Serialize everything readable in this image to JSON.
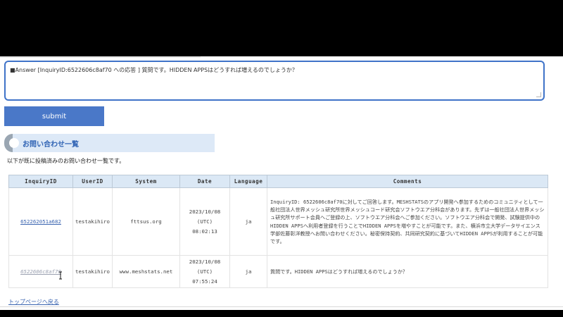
{
  "answer_field": {
    "value": "■Answer [InquiryID:6522606c8af70 への応答 ] 質問です。HIDDEN APPSはどうすれば増えるのでしょうか？"
  },
  "submit_label": "submit",
  "section": {
    "title": "お問い合わせ一覧",
    "intro": "以下が既に投稿済みのお問い合わせ一覧です。"
  },
  "table": {
    "headers": [
      "InquiryID",
      "UserID",
      "System",
      "Date",
      "Language",
      "Comments"
    ],
    "rows": [
      {
        "inquiry_id": "652262051a682",
        "user_id": "testakihiro",
        "system": "fttsus.org",
        "date": "2023/10/08",
        "tz": "(UTC)",
        "time": "08:02:13",
        "language": "ja",
        "comments": "InquiryID: 6522606c8af70に対してご回答します。MESHSTATSのアプリ開発へ参加するためのコミュニティとして一般社団法人世界メッシュ研究所世界メッシュコード研究会ソフトウエア分科会があります。先ずは一般社団法人世界メッシュ研究所サポート会員へご登録の上、ソフトウエア分科会へご参加ください。ソフトウエア分科会で開発、試験提供中のHIDDEN APPSへ利用者登録を行うことでHIDDEN APPSを増やすことが可能です。また、横浜市立大学データサイエンス学部佐藤彰洋教授へお問い合わせください。秘密保持契約、共同研究契約に基づいてHIDDEN APPSが利用することが可能です。"
      },
      {
        "inquiry_id": "6522606c8af70",
        "user_id": "testakihiro",
        "system": "www.meshstats.net",
        "date": "2023/10/08",
        "tz": "(UTC)",
        "time": "07:55:24",
        "language": "ja",
        "comments": "質問です。HIDDEN APPSはどうすれば増えるのでしょうか？"
      }
    ]
  },
  "footer_link": "トップページへ戻る",
  "colors": {
    "accent": "#3f73c8",
    "button": "#4a78c8",
    "header_bg": "#dbe8f5",
    "section_title": "#2f63b4"
  },
  "icons": [
    "text-cursor-icon",
    "resize-grip-icon",
    "section-bullet-icon"
  ]
}
